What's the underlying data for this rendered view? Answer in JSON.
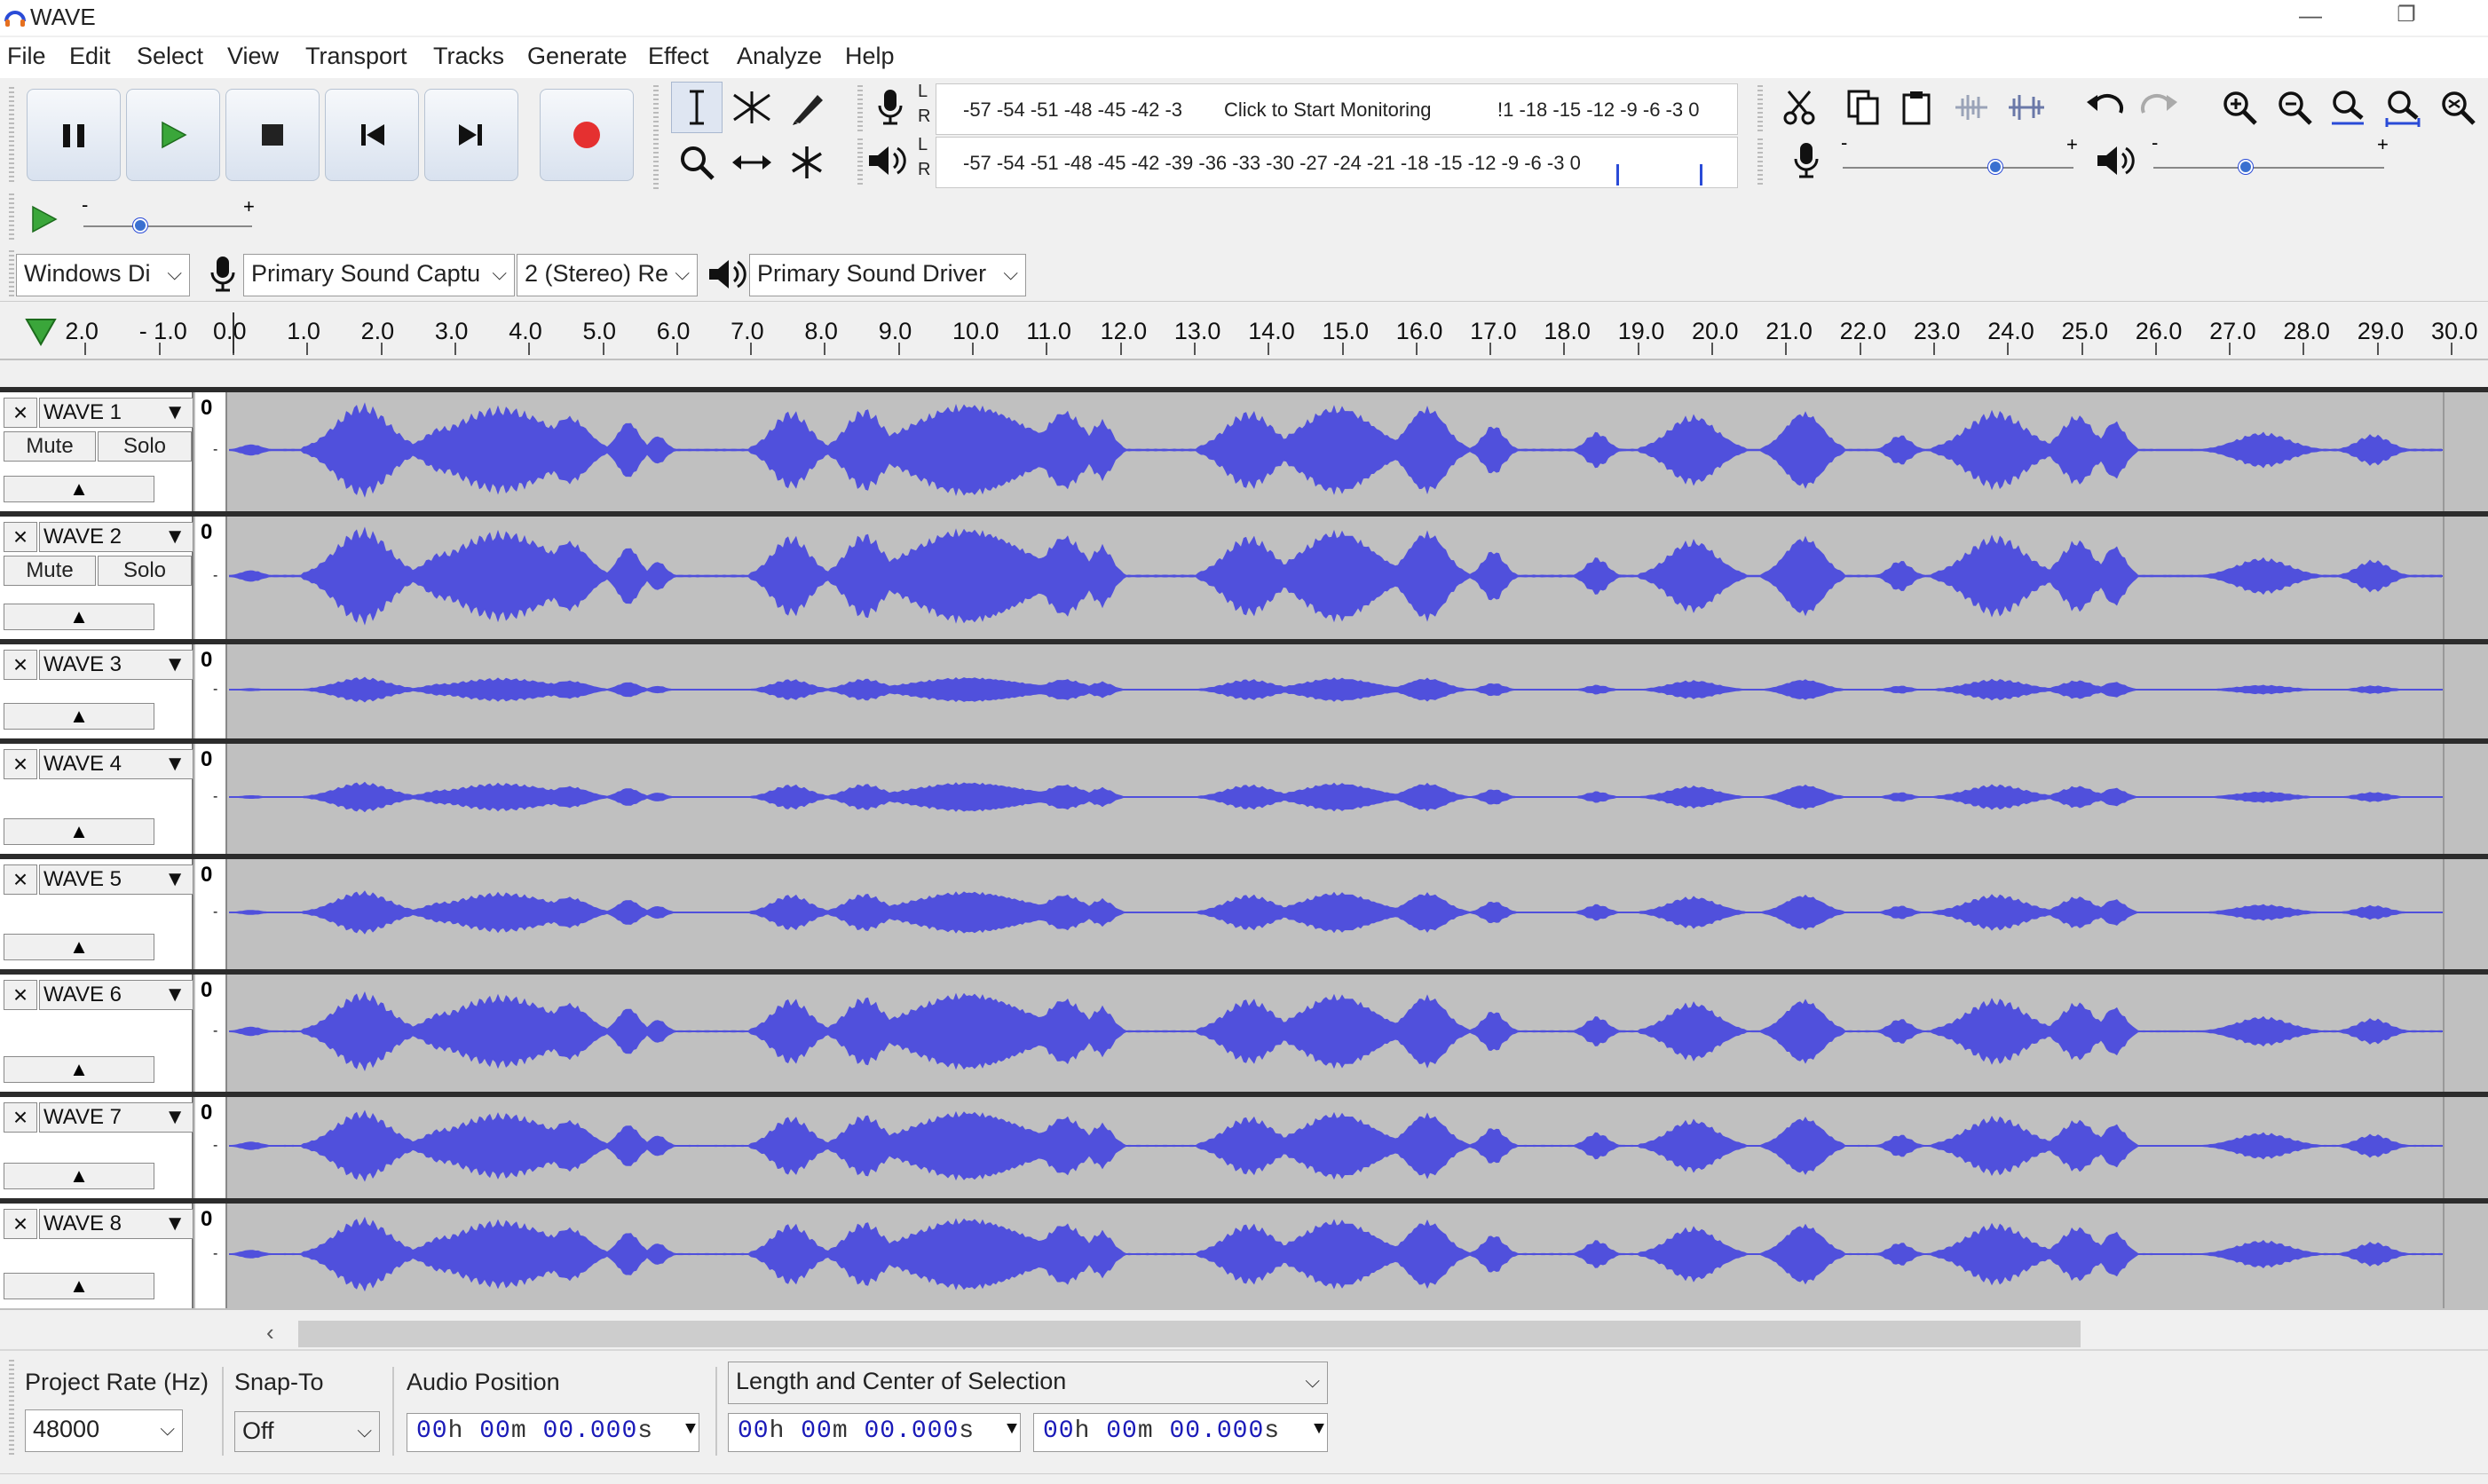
{
  "window": {
    "title": "WAVE",
    "minimize_glyph": "—",
    "restore_glyph": "❐"
  },
  "menu": [
    "File",
    "Edit",
    "Select",
    "View",
    "Transport",
    "Tracks",
    "Generate",
    "Effect",
    "Analyze",
    "Help"
  ],
  "transport": {
    "icons": [
      "pause-icon",
      "play-icon",
      "stop-icon",
      "skip-to-start-icon",
      "skip-to-end-icon",
      "record-icon"
    ]
  },
  "tools": [
    "selection-tool-icon",
    "envelope-tool-icon",
    "draw-tool-icon",
    "zoom-tool-icon",
    "time-shift-tool-icon",
    "multi-tool-icon"
  ],
  "meters": {
    "record_scale": "-57 -54 -51 -48 -45 -42 -3",
    "record_prompt": "Click to Start Monitoring",
    "record_scale_tail": "!1 -18 -15 -12  -9  -6  -3  0",
    "playback_scale": "-57 -54 -51 -48 -45 -42 -39 -36 -33 -30 -27 -24 -21 -18 -15 -12  -9  -6  -3  0",
    "left_label": "L",
    "right_label": "R"
  },
  "edit_icons": [
    "cut-icon",
    "copy-icon",
    "paste-icon",
    "trim-audio-icon",
    "silence-audio-icon",
    "undo-icon",
    "redo-icon",
    "zoom-in-icon",
    "zoom-out-icon",
    "fit-selection-icon",
    "fit-project-icon",
    "zoom-toggle-icon"
  ],
  "mixer": {
    "minus": "-",
    "plus": "+"
  },
  "play_at_speed": {
    "minus": "-",
    "plus": "+"
  },
  "devices": {
    "host": "Windows Di",
    "recording_device": "Primary Sound Captu",
    "channels": "2 (Stereo) Re",
    "playback_device": "Primary Sound Driver"
  },
  "ruler": {
    "labels": [
      "2.0",
      "- 1.0",
      "0.0",
      "1.0",
      "2.0",
      "3.0",
      "4.0",
      "5.0",
      "6.0",
      "7.0",
      "8.0",
      "9.0",
      "10.0",
      "11.0",
      "12.0",
      "13.0",
      "14.0",
      "15.0",
      "16.0",
      "17.0",
      "18.0",
      "19.0",
      "20.0",
      "21.0",
      "22.0",
      "23.0",
      "24.0",
      "25.0",
      "26.0",
      "27.0",
      "28.0",
      "29.0",
      "30.0"
    ]
  },
  "tracks": [
    {
      "name": "WAVE 1",
      "mute": "Mute",
      "solo": "Solo",
      "scale_top": "0",
      "amplitude": 1.0
    },
    {
      "name": "WAVE 2",
      "mute": "Mute",
      "solo": "Solo",
      "scale_top": "0",
      "amplitude": 1.0
    },
    {
      "name": "WAVE 3",
      "scale_top": "0",
      "amplitude": 0.35
    },
    {
      "name": "WAVE 4",
      "scale_top": "0",
      "amplitude": 0.35
    },
    {
      "name": "WAVE 5",
      "scale_top": "0",
      "amplitude": 0.5
    },
    {
      "name": "WAVE 6",
      "scale_top": "0",
      "amplitude": 0.85
    },
    {
      "name": "WAVE 7",
      "scale_top": "0",
      "amplitude": 0.9
    },
    {
      "name": "WAVE 8",
      "scale_top": "0",
      "amplitude": 0.9
    }
  ],
  "colors": {
    "waveform": "#5050dc",
    "track_bg": "#c0c0c0",
    "accent_green": "#3aa63a",
    "record_red": "#e53030"
  },
  "selection_toolbar": {
    "project_rate_label": "Project Rate (Hz)",
    "project_rate_value": "48000",
    "snap_to_label": "Snap-To",
    "snap_to_value": "Off",
    "audio_position_label": "Audio Position",
    "selection_mode": "Length and Center of Selection",
    "audio_position": {
      "h": "00",
      "m": "00",
      "s": "00.000"
    },
    "selection_length": {
      "h": "00",
      "m": "00",
      "s": "00.000"
    },
    "selection_center": {
      "h": "00",
      "m": "00",
      "s": "00.000"
    },
    "unit_h": "h",
    "unit_m": "m",
    "unit_s": "s"
  }
}
